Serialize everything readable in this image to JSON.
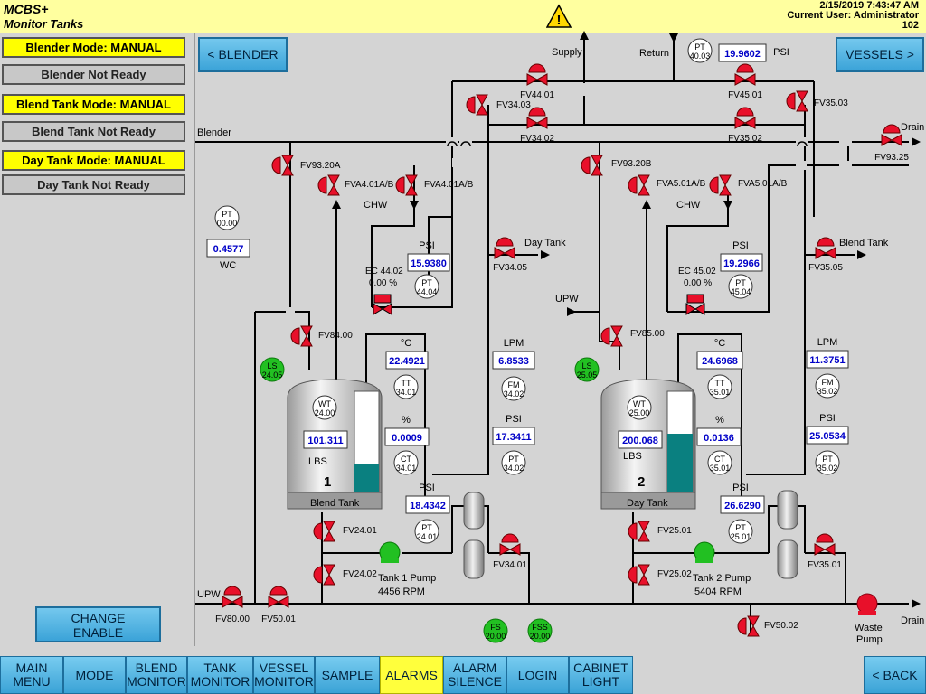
{
  "header": {
    "app_name": "MCBS+",
    "screen_name": "Monitor Tanks",
    "datetime": "2/15/2019 7:43:47 AM",
    "current_user": "Current User: Administrator",
    "station": "102",
    "alarm_symbol": "!"
  },
  "left_panel": {
    "blender_mode": "Blender Mode: MANUAL",
    "blender_status": "Blender Not Ready",
    "blend_tank_mode": "Blend Tank Mode: MANUAL",
    "blend_tank_status": "Blend Tank Not Ready",
    "day_tank_mode": "Day Tank Mode: MANUAL",
    "day_tank_status": "Day Tank Not Ready",
    "change_enable": "CHANGE\nENABLE"
  },
  "buttons": {
    "blender": "< BLENDER",
    "vessels": "VESSELS >"
  },
  "lines": {
    "supply": "Supply",
    "return": "Return",
    "blender": "Blender",
    "drain_top": "Drain",
    "drain_bottom": "Drain",
    "upw_left": "UPW",
    "upw_mid": "UPW",
    "day_tank": "Day Tank",
    "blend_tank": "Blend Tank",
    "chw_1": "CHW",
    "chw_2": "CHW",
    "wc": "WC",
    "waste_pump": "Waste\nPump"
  },
  "valves": {
    "fv4401": "FV44.01",
    "fv4501": "FV45.01",
    "fv3403": "FV34.03",
    "fv3503": "FV35.03",
    "fv3402": "FV34.02",
    "fv3502": "FV35.02",
    "fv9325": "FV93.25",
    "fv9320a": "FV93.20A",
    "fv9320b": "FV93.20B",
    "fva401a_1": "FVA4.01A/B",
    "fva401a_2": "FVA4.01A/B",
    "fva501a_1": "FVA5.01A/B",
    "fva501a_2": "FVA5.01A/B",
    "fv3405": "FV34.05",
    "fv3505": "FV35.05",
    "fv8400": "FV84.00",
    "fv8500": "FV85.00",
    "fv2401": "FV24.01",
    "fv2402": "FV24.02",
    "fv2501": "FV25.01",
    "fv2502": "FV25.02",
    "fv3401": "FV34.01",
    "fv3501": "FV35.01",
    "fv8000": "FV80.00",
    "fv5001": "FV50.01",
    "fv5002": "FV50.02"
  },
  "instruments": {
    "pt4003": {
      "tag1": "PT",
      "tag2": "40.03",
      "value": "19.9602",
      "unit": "PSI"
    },
    "pt0000": {
      "tag1": "PT",
      "tag2": "00.00",
      "value": "0.4577"
    },
    "pt4404": {
      "tag1": "PT",
      "tag2": "44.04",
      "value": "15.9380",
      "unit": "PSI"
    },
    "pt4504": {
      "tag1": "PT",
      "tag2": "45.04",
      "value": "19.2966",
      "unit": "PSI"
    },
    "ec4402": {
      "tag": "EC 44.02",
      "value": "0.00 %"
    },
    "ec4502": {
      "tag": "EC 45.02",
      "value": "0.00 %"
    },
    "tt3401": {
      "tag1": "TT",
      "tag2": "34.01",
      "value": "22.4921",
      "unit": "°C"
    },
    "tt3501": {
      "tag1": "TT",
      "tag2": "35.01",
      "value": "24.6968",
      "unit": "°C"
    },
    "ct3401": {
      "tag1": "CT",
      "tag2": "34.01",
      "value": "0.0009",
      "unit": "%"
    },
    "ct3501": {
      "tag1": "CT",
      "tag2": "35.01",
      "value": "0.0136",
      "unit": "%"
    },
    "fm3402": {
      "tag1": "FM",
      "tag2": "34.02",
      "value": "6.8533",
      "unit": "LPM"
    },
    "fm3502": {
      "tag1": "FM",
      "tag2": "35.02",
      "value": "11.3751",
      "unit": "LPM"
    },
    "pt3402": {
      "tag1": "PT",
      "tag2": "34.02",
      "value": "17.3411",
      "unit": "PSI"
    },
    "pt3502": {
      "tag1": "PT",
      "tag2": "35.02",
      "value": "25.0534",
      "unit": "PSI"
    },
    "pt2401": {
      "tag1": "PT",
      "tag2": "24.01",
      "value": "18.4342",
      "unit": "PSI"
    },
    "pt2501": {
      "tag1": "PT",
      "tag2": "25.01",
      "value": "26.6290",
      "unit": "PSI"
    },
    "wt2400": {
      "tag1": "WT",
      "tag2": "24.00",
      "value": "101.311",
      "unit": "LBS"
    },
    "wt2500": {
      "tag1": "WT",
      "tag2": "25.00",
      "value": "200.068",
      "unit": "LBS"
    },
    "ls2405": {
      "tag1": "LS",
      "tag2": "24.05"
    },
    "ls2505": {
      "tag1": "LS",
      "tag2": "25.05"
    },
    "fs2000": {
      "tag1": "FS",
      "tag2": "20.00"
    },
    "fss2000": {
      "tag1": "FSS",
      "tag2": "20.00"
    }
  },
  "tanks": {
    "tank1": {
      "number": "1",
      "name": "Blend Tank",
      "level_fraction": 0.28
    },
    "tank2": {
      "number": "2",
      "name": "Day Tank",
      "level_fraction": 0.58
    }
  },
  "pumps": {
    "pump1": {
      "name": "Tank 1 Pump",
      "speed": "4456 RPM"
    },
    "pump2": {
      "name": "Tank 2 Pump",
      "speed": "5404 RPM"
    }
  },
  "nav": [
    {
      "label": "MAIN\nMENU",
      "active": false
    },
    {
      "label": "MODE",
      "active": false
    },
    {
      "label": "BLEND\nMONITOR",
      "active": false
    },
    {
      "label": "TANK\nMONITOR",
      "active": false
    },
    {
      "label": "VESSEL\nMONITOR",
      "active": false
    },
    {
      "label": "SAMPLE",
      "active": false
    },
    {
      "label": "ALARMS",
      "active": true
    },
    {
      "label": "ALARM\nSILENCE",
      "active": false
    },
    {
      "label": "LOGIN",
      "active": false
    },
    {
      "label": "CABINET\nLIGHT",
      "active": false
    },
    {
      "label": "< BACK",
      "active": false
    }
  ],
  "colors": {
    "header_bg": "#ffff9f",
    "mode_yellow": "#ffff00",
    "valve_red": "#e8102a",
    "pump_green": "#22c022",
    "tank_fill": "#0a8080",
    "value_blue": "#0000c8"
  }
}
